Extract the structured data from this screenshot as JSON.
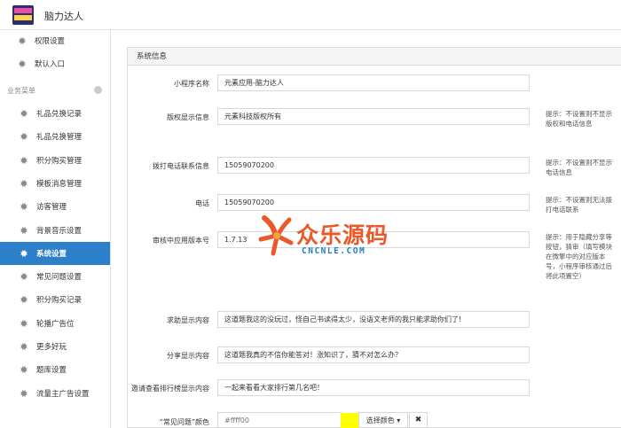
{
  "header": {
    "app_title": "脑力达人"
  },
  "sidebar": {
    "top_items": [
      {
        "label": "权限设置",
        "icon": "gear-icon"
      },
      {
        "label": "默认入口",
        "icon": "gear-icon"
      }
    ],
    "section_label": "业务菜单",
    "items": [
      {
        "label": "礼品兑换记录",
        "icon": "gear-icon",
        "active": false
      },
      {
        "label": "礼品兑换管理",
        "icon": "gear-icon",
        "active": false
      },
      {
        "label": "积分购买管理",
        "icon": "gear-icon",
        "active": false
      },
      {
        "label": "模板消息管理",
        "icon": "gear-icon",
        "active": false
      },
      {
        "label": "访客管理",
        "icon": "gear-icon",
        "active": false
      },
      {
        "label": "背景音乐设置",
        "icon": "gear-icon",
        "active": false
      },
      {
        "label": "系统设置",
        "icon": "gear-icon",
        "active": true
      },
      {
        "label": "常见问题设置",
        "icon": "gear-icon",
        "active": false
      },
      {
        "label": "积分购买记录",
        "icon": "gear-icon",
        "active": false
      },
      {
        "label": "轮播广告位",
        "icon": "gear-icon",
        "active": false
      },
      {
        "label": "更多好玩",
        "icon": "gear-icon",
        "active": false
      },
      {
        "label": "题库设置",
        "icon": "gear-icon",
        "active": false
      },
      {
        "label": "流量主广告设置",
        "icon": "gear-icon",
        "active": false
      }
    ],
    "active_color": "#2c7fc9"
  },
  "panel": {
    "title": "系统信息",
    "fields": [
      {
        "label": "小程序名称",
        "value": "元素应用-脑力达人"
      },
      {
        "label": "版权显示信息",
        "value": "元素科技版权所有",
        "hint": "提示：不设置则不显示版权和电话信息"
      },
      {
        "label": "拨打电话联系信息",
        "value": "15059070200",
        "hint": "提示：不设置则不显示电话信息"
      },
      {
        "label": "电话",
        "value": "15059070200",
        "hint": "提示：不设置则无法拨打电话联系"
      },
      {
        "label": "审核中应用版本号",
        "value": "1.7.13",
        "hint": "提示：用于隐藏分享等按钮，猜审（填写模块在微擎中的对应版本号，小程序审核通过后将此项置空）"
      },
      {
        "label": "求助显示内容",
        "value": "这道题我这的没玩过，怪自己书读得太少，没语文老师的我只能求助你们了!"
      },
      {
        "label": "分享显示内容",
        "value": "这道题我真的不信你能答对！涨知识了，猜不对怎么办？"
      },
      {
        "label": "邀请查看排行榜显示内容",
        "value": "一起来看看大家排行第几名吧！"
      }
    ],
    "color_field": {
      "label": "“常见问题”颜色",
      "value": "#ffff00",
      "placeholder": "#ffff00",
      "swatch_color": "#ffff00",
      "choose_label": "选择颜色 ▾",
      "clear_label": "✖"
    }
  },
  "watermark": {
    "title": "众乐源码",
    "subtitle": "CNCNLE.COM",
    "color": "#e95a2b",
    "sub_color": "#1e7fc4"
  }
}
